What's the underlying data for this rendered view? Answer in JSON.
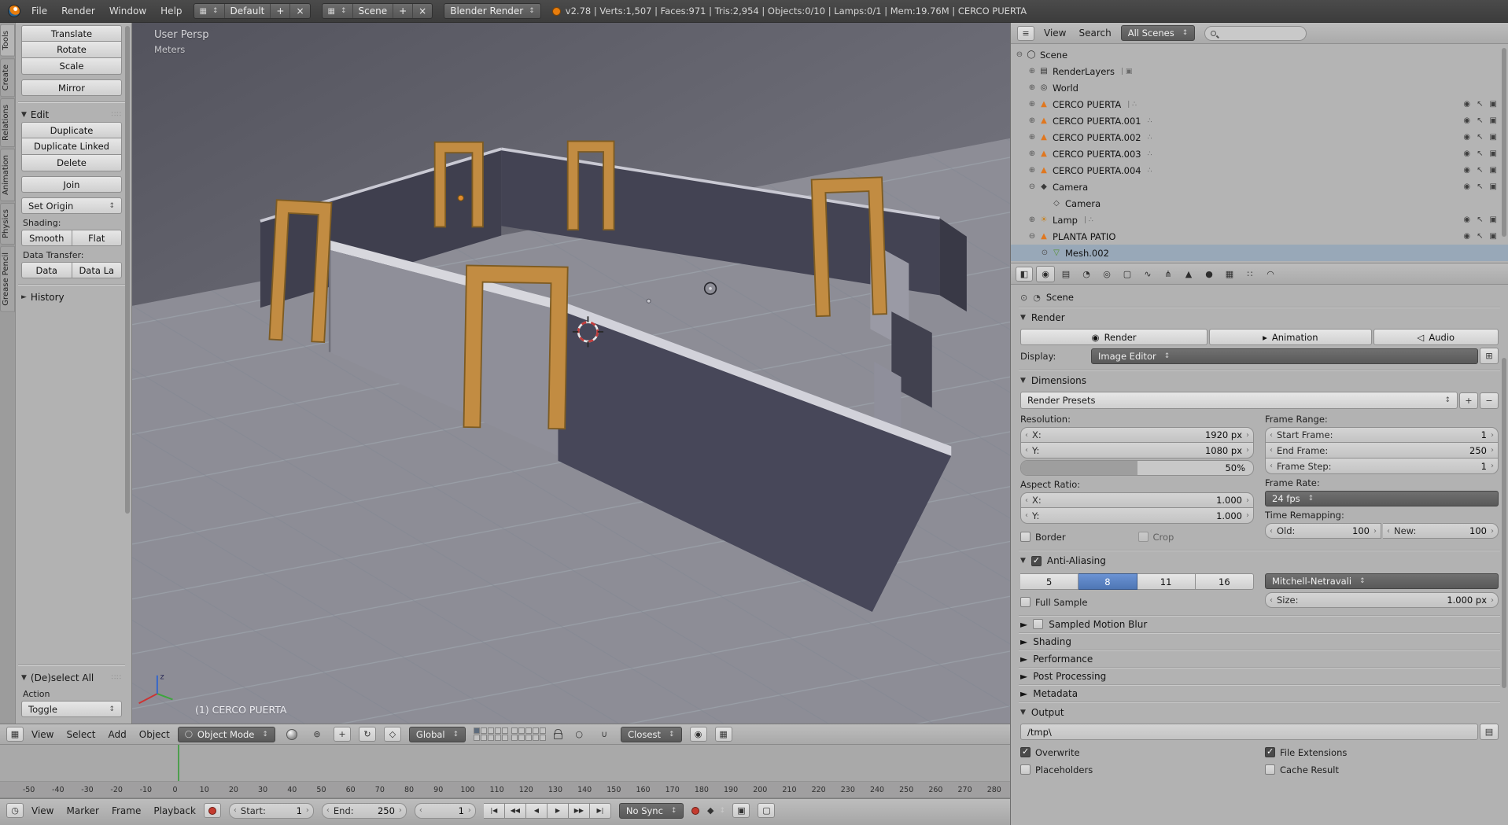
{
  "header": {
    "menus": [
      "File",
      "Render",
      "Window",
      "Help"
    ],
    "layout": {
      "value": "Default",
      "add": "+",
      "close": "×"
    },
    "scene": {
      "value": "Scene",
      "add": "+",
      "close": "×"
    },
    "engine": "Blender Render",
    "stats": "v2.78 | Verts:1,507 | Faces:971 | Tris:2,954 | Objects:0/10 | Lamps:0/1 | Mem:19.76M | CERCO PUERTA"
  },
  "tool_shelf": {
    "tabs": [
      {
        "label": "Tools",
        "cls": "active"
      },
      {
        "label": "Create"
      },
      {
        "label": "Relations"
      },
      {
        "label": "Animation"
      },
      {
        "label": "Physics"
      },
      {
        "label": "Grease Pencil"
      }
    ],
    "transform": [
      "Translate",
      "Rotate",
      "Scale"
    ],
    "mirror": "Mirror",
    "edit_title": "Edit",
    "edit_group": [
      "Duplicate",
      "Duplicate Linked",
      "Delete"
    ],
    "join": "Join",
    "set_origin": "Set Origin",
    "shading_label": "Shading:",
    "smooth": "Smooth",
    "flat": "Flat",
    "data_transfer_label": "Data Transfer:",
    "data": "Data",
    "data_layout": "Data La",
    "history": "History",
    "deselect_title": "(De)select All",
    "action_label": "Action",
    "toggle": "Toggle"
  },
  "viewport": {
    "persp": "User Persp",
    "unit": "Meters",
    "active_object": "(1) CERCO PUERTA",
    "menus": [
      "View",
      "Select",
      "Add",
      "Object"
    ],
    "mode": "Object Mode",
    "orientation": "Global",
    "snap_target": "Closest"
  },
  "timeline": {
    "ruler": [
      "-50",
      "-40",
      "-30",
      "-20",
      "-10",
      "0",
      "10",
      "20",
      "30",
      "40",
      "50",
      "60",
      "70",
      "80",
      "90",
      "100",
      "110",
      "120",
      "130",
      "140",
      "150",
      "160",
      "170",
      "180",
      "190",
      "200",
      "210",
      "220",
      "230",
      "240",
      "250",
      "260",
      "270",
      "280"
    ],
    "menus": [
      "View",
      "Marker",
      "Frame",
      "Playback"
    ],
    "start_label": "Start:",
    "start": "1",
    "end_label": "End:",
    "end": "250",
    "frame": "1",
    "playback": [
      "|◀",
      "◀◀",
      "◀",
      "▶",
      "▶▶",
      "▶|"
    ],
    "sync": "No Sync"
  },
  "outliner": {
    "menus": [
      "View",
      "Search"
    ],
    "scope": "All Scenes",
    "eye_icon": "◉",
    "select_icon": "↖",
    "render_icon": "▣",
    "rows": [
      {
        "ind": 0,
        "exp": "⊖",
        "glyph": "◯",
        "color": "#2e2e2e",
        "label": "Scene",
        "trail": "",
        "right": false
      },
      {
        "ind": 1,
        "exp": "⊕",
        "glyph": "▤",
        "color": "#2e2e2e",
        "label": "RenderLayers",
        "trail": "|  ▣",
        "right": false
      },
      {
        "ind": 1,
        "exp": "⊕",
        "glyph": "◎",
        "color": "#2e2e2e",
        "label": "World",
        "trail": "",
        "right": false
      },
      {
        "ind": 1,
        "exp": "⊕",
        "glyph": "▲",
        "color": "#e0771f",
        "label": "CERCO PUERTA",
        "trail": "|  ∴",
        "right": true
      },
      {
        "ind": 1,
        "exp": "⊕",
        "glyph": "▲",
        "color": "#e0771f",
        "label": "CERCO PUERTA.001",
        "trail": "∴",
        "right": true
      },
      {
        "ind": 1,
        "exp": "⊕",
        "glyph": "▲",
        "color": "#e0771f",
        "label": "CERCO PUERTA.002",
        "trail": "∴",
        "right": true
      },
      {
        "ind": 1,
        "exp": "⊕",
        "glyph": "▲",
        "color": "#e0771f",
        "label": "CERCO PUERTA.003",
        "trail": "∴",
        "right": true
      },
      {
        "ind": 1,
        "exp": "⊕",
        "glyph": "▲",
        "color": "#e0771f",
        "label": "CERCO PUERTA.004",
        "trail": "∴",
        "right": true
      },
      {
        "ind": 1,
        "exp": "⊖",
        "glyph": "◆",
        "color": "#3a3a3a",
        "label": "Camera",
        "trail": "",
        "right": true
      },
      {
        "ind": 2,
        "exp": "",
        "glyph": "◇",
        "color": "#3a3a3a",
        "label": "Camera",
        "trail": "",
        "right": false
      },
      {
        "ind": 1,
        "exp": "⊕",
        "glyph": "☀",
        "color": "#c8821e",
        "label": "Lamp",
        "trail": "|  ∴",
        "right": true
      },
      {
        "ind": 1,
        "exp": "⊖",
        "glyph": "▲",
        "color": "#e0771f",
        "label": "PLANTA PATIO",
        "trail": "",
        "right": true
      },
      {
        "ind": 2,
        "exp": "⊙",
        "glyph": "▽",
        "color": "#53902c",
        "label": "Mesh.002",
        "trail": "",
        "right": false,
        "cls": "sel"
      }
    ]
  },
  "properties": {
    "tabs": [
      {
        "glyph": "◉",
        "cls": "active"
      },
      {
        "glyph": "▤"
      },
      {
        "glyph": "◔"
      },
      {
        "glyph": "◎"
      },
      {
        "glyph": "▢"
      },
      {
        "glyph": "∿"
      },
      {
        "glyph": "⋔"
      },
      {
        "glyph": "▲"
      },
      {
        "glyph": "●"
      },
      {
        "glyph": "▦"
      },
      {
        "glyph": "∷"
      },
      {
        "glyph": "◠"
      }
    ],
    "breadcrumb": "Scene",
    "render": {
      "title": "Render",
      "render_btn": "Render",
      "animation_btn": "Animation",
      "audio_btn": "Audio",
      "display_label": "Display:",
      "display": "Image Editor"
    },
    "dimensions": {
      "title": "Dimensions",
      "presets": "Render Presets",
      "resolution_label": "Resolution:",
      "x_label": "X:",
      "x": "1920 px",
      "y_label": "Y:",
      "y": "1080 px",
      "percent": "50%",
      "aspect_label": "Aspect Ratio:",
      "ax_label": "X:",
      "ax": "1.000",
      "ay_label": "Y:",
      "ay": "1.000",
      "border": {
        "label": "Border",
        "checked": false
      },
      "crop": {
        "label": "Crop",
        "checked": false
      },
      "frame_range_label": "Frame Range:",
      "start_label": "Start Frame:",
      "start": "1",
      "end_label": "End Frame:",
      "end": "250",
      "step_label": "Frame Step:",
      "step": "1",
      "frame_rate_label": "Frame Rate:",
      "fps": "24 fps",
      "remap_label": "Time Remapping:",
      "old_label": "Old:",
      "old": "100",
      "new_label": "New:",
      "new": "100"
    },
    "aa": {
      "title": "Anti-Aliasing",
      "checked": true,
      "samples": [
        {
          "label": "5"
        },
        {
          "label": "8",
          "cls": "active"
        },
        {
          "label": "11"
        },
        {
          "label": "16"
        }
      ],
      "filter": "Mitchell-Netravali",
      "full_sample": {
        "label": "Full Sample",
        "checked": false
      },
      "size_label": "Size:",
      "size": "1.000 px"
    },
    "collapsed": [
      {
        "label": "Sampled Motion Blur",
        "cb": true
      },
      {
        "label": "Shading"
      },
      {
        "label": "Performance"
      },
      {
        "label": "Post Processing"
      },
      {
        "label": "Metadata"
      }
    ],
    "output": {
      "title": "Output",
      "path": "/tmp\\",
      "overwrite": {
        "label": "Overwrite",
        "checked": true
      },
      "file_extensions": {
        "label": "File Extensions",
        "checked": true
      },
      "placeholders": {
        "label": "Placeholders",
        "checked": false
      },
      "cache_result": {
        "label": "Cache Result",
        "checked": false
      }
    }
  }
}
